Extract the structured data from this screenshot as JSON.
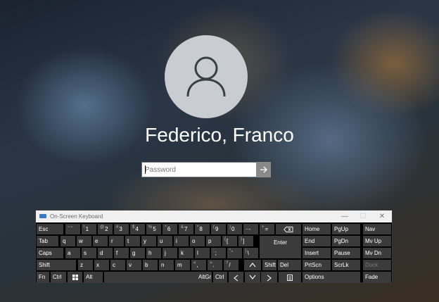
{
  "user": {
    "name": "Federico, Franco"
  },
  "password": {
    "placeholder": "Password",
    "value": ""
  },
  "osk": {
    "title": "On-Screen Keyboard",
    "window_buttons": [
      "—",
      "☐",
      "✕"
    ],
    "rows": [
      [
        {
          "l": "Esc"
        },
        {
          "s": "~",
          "l": "`"
        },
        {
          "s": "!",
          "l": "1"
        },
        {
          "s": "@",
          "l": "2"
        },
        {
          "s": "#",
          "l": "3"
        },
        {
          "s": "$",
          "l": "4"
        },
        {
          "s": "%",
          "l": "5"
        },
        {
          "s": "^",
          "l": "6"
        },
        {
          "s": "&",
          "l": "7"
        },
        {
          "s": "*",
          "l": "8"
        },
        {
          "s": "(",
          "l": "9"
        },
        {
          "s": ")",
          "l": "0"
        },
        {
          "s": "_",
          "l": "-"
        },
        {
          "s": "+",
          "l": "="
        },
        {
          "icon": "backspace-icon"
        },
        {
          "l": "Home"
        },
        {
          "l": "PgUp"
        },
        {
          "l": "Nav"
        }
      ],
      [
        {
          "l": "Tab"
        },
        {
          "l": "q"
        },
        {
          "l": "w"
        },
        {
          "l": "e"
        },
        {
          "l": "r"
        },
        {
          "l": "t"
        },
        {
          "l": "y"
        },
        {
          "l": "u"
        },
        {
          "l": "i"
        },
        {
          "l": "o"
        },
        {
          "l": "p"
        },
        {
          "s": "{",
          "l": "["
        },
        {
          "s": "}",
          "l": "]"
        },
        {
          "l": "Enter"
        },
        {
          "l": "End"
        },
        {
          "l": "PgDn"
        },
        {
          "l": "Mv Up"
        }
      ],
      [
        {
          "l": "Caps"
        },
        {
          "l": "a"
        },
        {
          "l": "s"
        },
        {
          "l": "d"
        },
        {
          "l": "f"
        },
        {
          "l": "g"
        },
        {
          "l": "h"
        },
        {
          "l": "j"
        },
        {
          "l": "k"
        },
        {
          "l": "l"
        },
        {
          "s": ":",
          "l": ";"
        },
        {
          "s": "\"",
          "l": "'"
        },
        {
          "s": "|",
          "l": "\\"
        },
        {
          "l": "Insert"
        },
        {
          "l": "Pause"
        },
        {
          "l": "Mv Dn"
        }
      ],
      [
        {
          "l": "Shift"
        },
        {
          "l": "z"
        },
        {
          "l": "x"
        },
        {
          "l": "c"
        },
        {
          "l": "v"
        },
        {
          "l": "b"
        },
        {
          "l": "n"
        },
        {
          "l": "m"
        },
        {
          "s": "<",
          "l": ","
        },
        {
          "s": ">",
          "l": "."
        },
        {
          "s": "?",
          "l": "/"
        },
        {
          "icon": "arrow-up-icon"
        },
        {
          "l": "Shift"
        },
        {
          "l": "Del"
        },
        {
          "l": "PrtScn"
        },
        {
          "l": "ScrLk"
        },
        {
          "l": "Dock"
        }
      ],
      [
        {
          "l": "Fn"
        },
        {
          "l": "Ctrl"
        },
        {
          "icon": "windows-logo-icon"
        },
        {
          "l": "Alt"
        },
        {
          "l": ""
        },
        {
          "l": "AltGr"
        },
        {
          "l": "Ctrl"
        },
        {
          "icon": "arrow-left-icon"
        },
        {
          "icon": "arrow-down-icon"
        },
        {
          "icon": "arrow-right-icon"
        },
        {
          "icon": "menu-key-icon"
        },
        {
          "l": "Options"
        },
        {
          "l": "Fade"
        }
      ]
    ]
  }
}
